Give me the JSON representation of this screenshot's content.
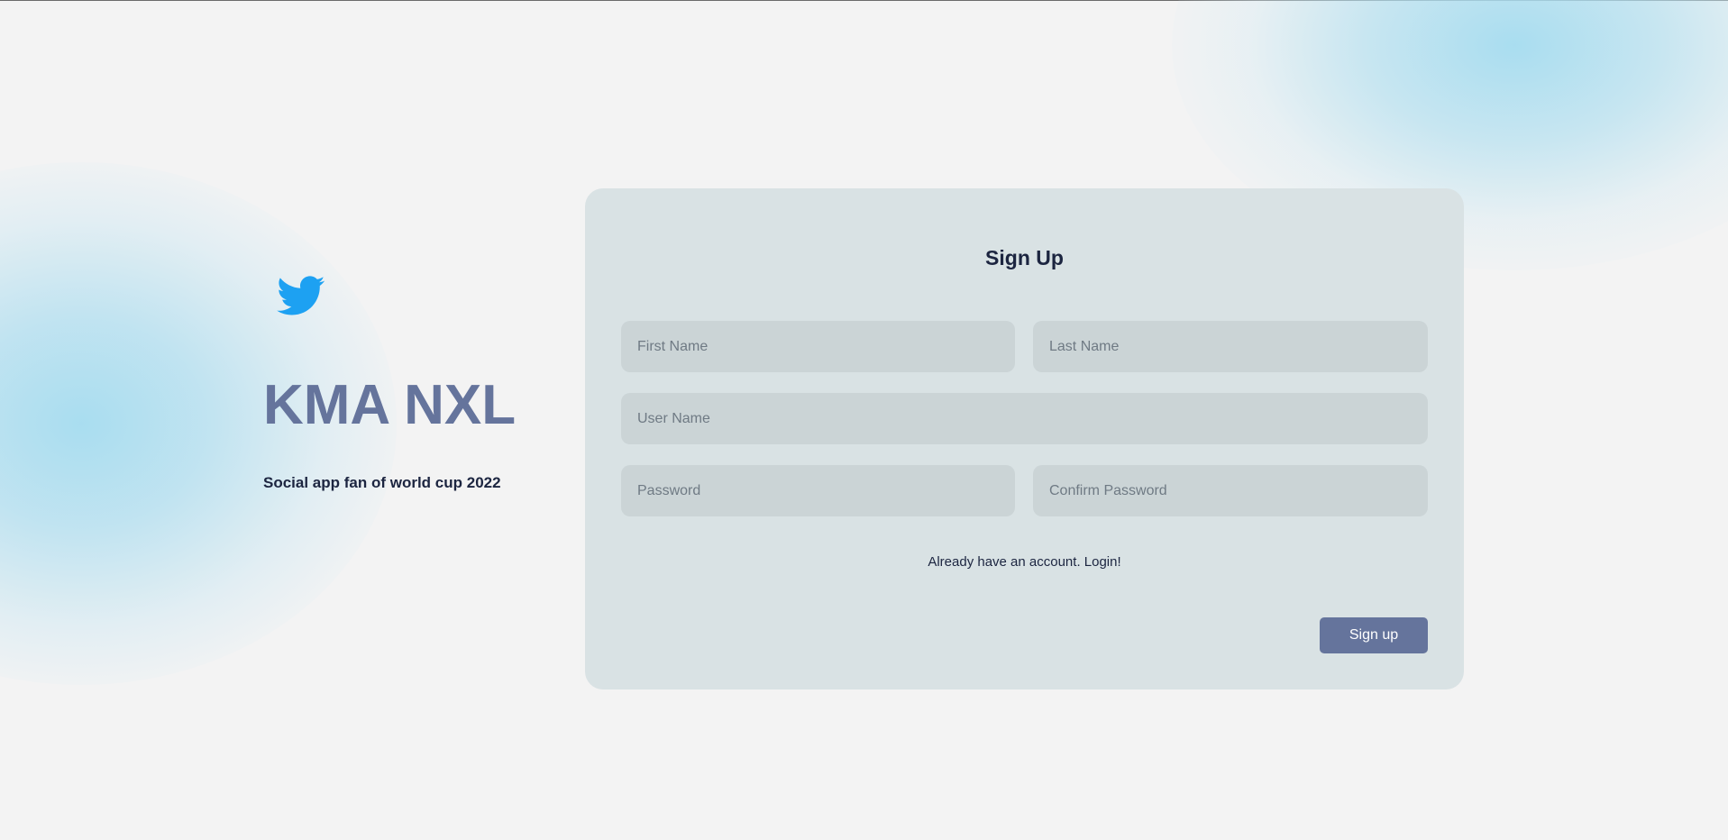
{
  "brand": {
    "logo_icon": "twitter-bird-icon",
    "title": "KMA NXL",
    "tagline": "Social app fan of world cup 2022"
  },
  "form": {
    "title": "Sign Up",
    "first_name_placeholder": "First Name",
    "last_name_placeholder": "Last Name",
    "user_name_placeholder": "User Name",
    "password_placeholder": "Password",
    "confirm_password_placeholder": "Confirm Password",
    "login_link": "Already have an account. Login!",
    "submit_label": "Sign up"
  },
  "colors": {
    "background": "#f3f3f3",
    "card": "#d9e2e4",
    "input": "#cbd4d6",
    "accent": "#65749c",
    "text": "#1c2540",
    "logo": "#1da1f2"
  }
}
